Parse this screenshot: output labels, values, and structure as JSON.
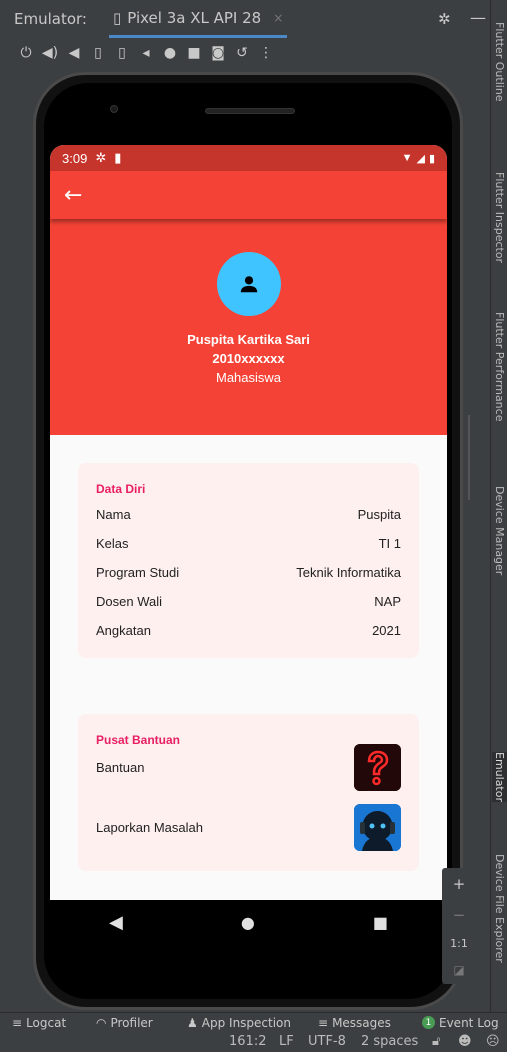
{
  "emulator": {
    "title": "Emulator:",
    "device_tab": "Pixel 3a XL API 28",
    "tab_close": "×",
    "toolbar_icons": [
      "power-icon",
      "volume-up-icon",
      "volume-down-icon",
      "rotate-left-icon",
      "rotate-right-icon",
      "back-icon",
      "home-icon",
      "overview-icon",
      "screenshot-icon",
      "snapshot-icon",
      "more-icon"
    ]
  },
  "right_tabs": [
    "Flutter Outline",
    "Flutter Inspector",
    "Flutter Performance",
    "Device Manager",
    "Emulator",
    "Device File Explorer"
  ],
  "status_bar": {
    "time": "3:09"
  },
  "app": {
    "profile": {
      "name": "Puspita Kartika Sari",
      "nim": "2010xxxxxx",
      "role": "Mahasiswa"
    },
    "data_diri": {
      "title": "Data Diri",
      "rows": [
        {
          "label": "Nama",
          "value": "Puspita"
        },
        {
          "label": "Kelas",
          "value": "TI 1"
        },
        {
          "label": "Program Studi",
          "value": "Teknik Informatika"
        },
        {
          "label": "Dosen Wali",
          "value": "NAP"
        },
        {
          "label": "Angkatan",
          "value": "2021"
        }
      ]
    },
    "pusat_bantuan": {
      "title": "Pusat Bantuan",
      "items": [
        {
          "label": "Bantuan",
          "icon": "question-mark-icon"
        },
        {
          "label": "Laporkan Masalah",
          "icon": "hacker-icon"
        }
      ]
    }
  },
  "zoom": {
    "plus": "+",
    "minus": "−",
    "ratio": "1:1"
  },
  "bottom_tools": {
    "logcat": "Logcat",
    "profiler": "Profiler",
    "app_inspection": "App Inspection",
    "messages": "Messages",
    "event_log_count": "1",
    "event_log": "Event Log"
  },
  "status_line": {
    "position": "161:2",
    "line_sep": "LF",
    "encoding": "UTF-8",
    "indent": "2 spaces"
  },
  "colors": {
    "primary": "#f44336",
    "status_bar": "#c6352c",
    "accent_title": "#e91e63",
    "avatar": "#40c4ff",
    "card_bg": "#fdf0ef"
  }
}
